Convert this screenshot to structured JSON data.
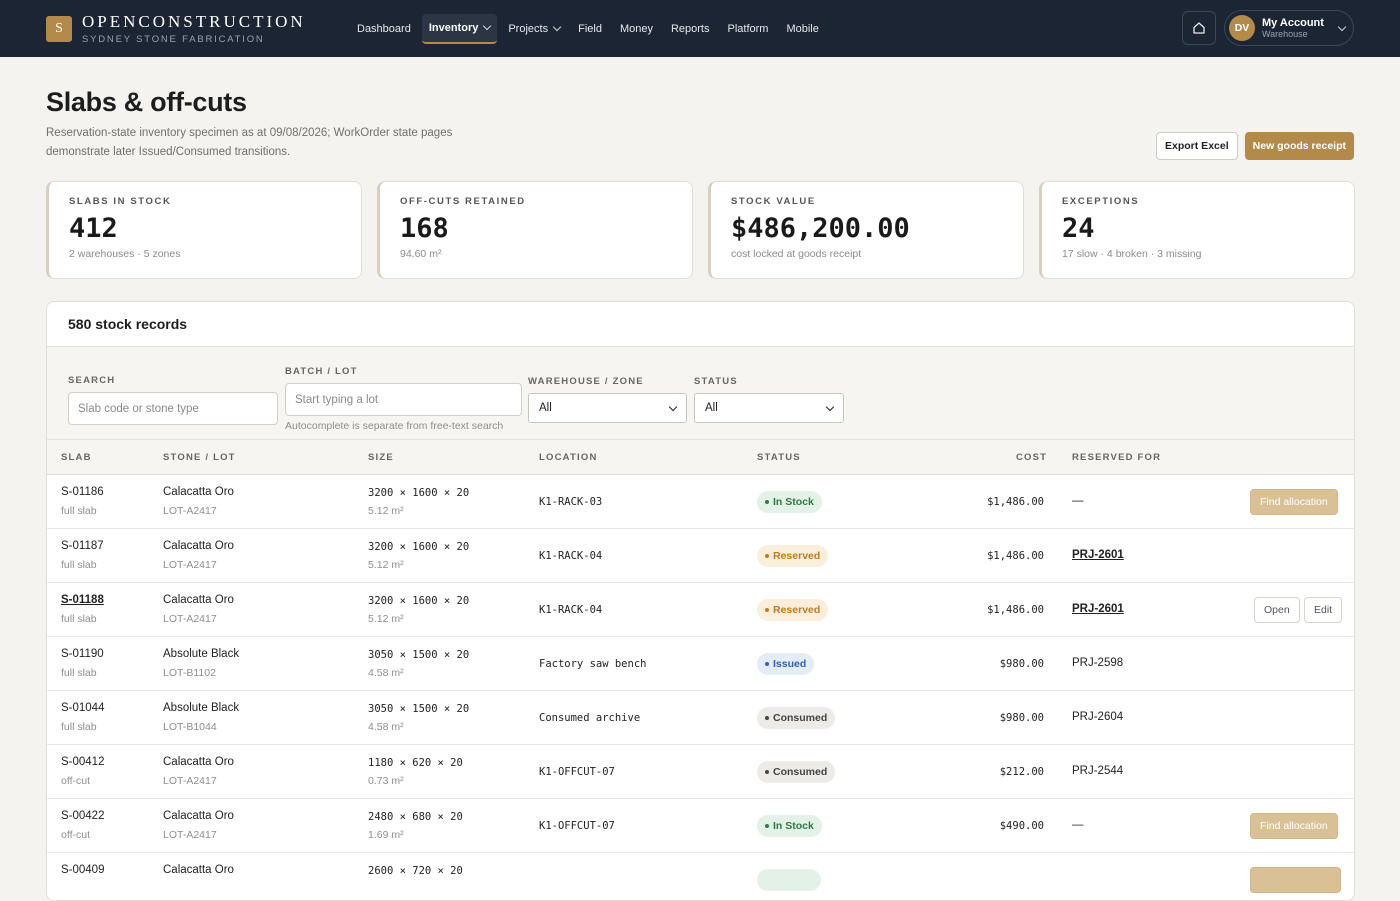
{
  "brand": {
    "logo_letter": "S",
    "name": "OPENCONSTRUCTION",
    "subtitle": "SYDNEY STONE FABRICATION"
  },
  "nav": {
    "items": [
      {
        "label": "Dashboard",
        "has_chevron": false,
        "active": false
      },
      {
        "label": "Inventory",
        "has_chevron": true,
        "active": true
      },
      {
        "label": "Projects",
        "has_chevron": true,
        "active": false
      },
      {
        "label": "Field",
        "has_chevron": false,
        "active": false
      },
      {
        "label": "Money",
        "has_chevron": false,
        "active": false
      },
      {
        "label": "Reports",
        "has_chevron": false,
        "active": false
      },
      {
        "label": "Platform",
        "has_chevron": false,
        "active": false
      },
      {
        "label": "Mobile",
        "has_chevron": false,
        "active": false
      }
    ]
  },
  "account": {
    "initials": "DV",
    "name": "My Account",
    "role": "Warehouse"
  },
  "header": {
    "title": "Slabs & off-cuts",
    "description": "Reservation-state inventory specimen as at 09/08/2026; WorkOrder state pages demonstrate later Issued/Consumed transitions.",
    "export_label": "Export Excel",
    "new_label": "New goods receipt"
  },
  "stats": [
    {
      "label": "SLABS IN STOCK",
      "value": "412",
      "sub": "2 warehouses · 5 zones"
    },
    {
      "label": "OFF-CUTS RETAINED",
      "value": "168",
      "sub": "94.60 m²"
    },
    {
      "label": "STOCK VALUE",
      "value": "$486,200.00",
      "sub": "cost locked at goods receipt"
    },
    {
      "label": "EXCEPTIONS",
      "value": "24",
      "sub": "17 slow · 4 broken · 3 missing"
    }
  ],
  "panel": {
    "title": "580 stock records"
  },
  "filters": {
    "search_label": "SEARCH",
    "search_placeholder": "Slab code or stone type",
    "batch_label": "BATCH / LOT",
    "batch_placeholder": "Start typing a lot",
    "batch_hint": "Autocomplete is separate from free-text search",
    "warehouse_label": "WAREHOUSE / ZONE",
    "warehouse_value": "All",
    "status_label": "STATUS",
    "status_value": "All"
  },
  "table": {
    "columns": [
      "SLAB",
      "STONE / LOT",
      "SIZE",
      "LOCATION",
      "STATUS",
      "COST",
      "RESERVED FOR"
    ],
    "rows": [
      {
        "slab": "S-01186",
        "kind": "full slab",
        "stone": "Calacatta Oro",
        "lot": "LOT-A2417",
        "dims": "3200 × 1600 × 20",
        "area": "5.12 m²",
        "location": "K1-RACK-03",
        "status": "In Stock",
        "cost": "$1,486.00",
        "reserved": "—",
        "action": "Find allocation"
      },
      {
        "slab": "S-01187",
        "kind": "full slab",
        "stone": "Calacatta Oro",
        "lot": "LOT-A2417",
        "dims": "3200 × 1600 × 20",
        "area": "5.12 m²",
        "location": "K1-RACK-04",
        "status": "Reserved",
        "cost": "$1,486.00",
        "reserved": "PRJ-2601"
      },
      {
        "slab": "S-01188",
        "kind": "full slab",
        "stone": "Calacatta Oro",
        "lot": "LOT-A2417",
        "dims": "3200 × 1600 × 20",
        "area": "5.12 m²",
        "location": "K1-RACK-04",
        "status": "Reserved",
        "cost": "$1,486.00",
        "reserved": "PRJ-2601",
        "open_label": "Open",
        "edit_label": "Edit"
      },
      {
        "slab": "S-01190",
        "kind": "full slab",
        "stone": "Absolute Black",
        "lot": "LOT-B1102",
        "dims": "3050 × 1500 × 20",
        "area": "4.58 m²",
        "location": "Factory saw bench",
        "status": "Issued",
        "cost": "$980.00",
        "reserved": "PRJ-2598"
      },
      {
        "slab": "S-01044",
        "kind": "full slab",
        "stone": "Absolute Black",
        "lot": "LOT-B1044",
        "dims": "3050 × 1500 × 20",
        "area": "4.58 m²",
        "location": "Consumed archive",
        "status": "Consumed",
        "cost": "$980.00",
        "reserved": "PRJ-2604"
      },
      {
        "slab": "S-00412",
        "kind": "off-cut",
        "stone": "Calacatta Oro",
        "lot": "LOT-A2417",
        "dims": "1180 × 620 × 20",
        "area": "0.73 m²",
        "location": "K1-OFFCUT-07",
        "status": "Consumed",
        "cost": "$212.00",
        "reserved": "PRJ-2544"
      },
      {
        "slab": "S-00422",
        "kind": "off-cut",
        "stone": "Calacatta Oro",
        "lot": "LOT-A2417",
        "dims": "2480 × 680 × 20",
        "area": "1.69 m²",
        "location": "K1-OFFCUT-07",
        "status": "In Stock",
        "cost": "$490.00",
        "reserved": "—",
        "action": "Find allocation"
      },
      {
        "slab": "S-00409",
        "stone": "Calacatta Oro",
        "dims": "2600 × 720 × 20"
      }
    ]
  },
  "colors": {
    "topbar": "#1c2533",
    "accent_gold": "#b38a4a",
    "background": "#f4f3ef",
    "instock": "#2f7a47",
    "reserved": "#c27a1e",
    "issued": "#3060b0",
    "consumed": "#444444"
  }
}
